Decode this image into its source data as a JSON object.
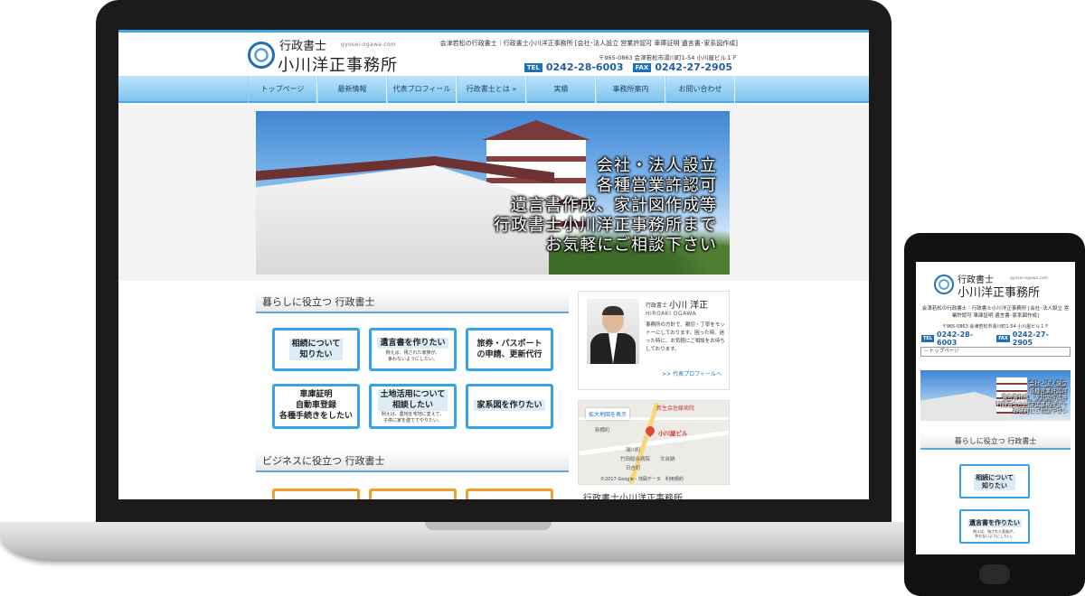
{
  "site": {
    "logo_line1": "行政書士",
    "logo_line2": "小川洋正事務所",
    "domain": "gyosei-ogawa.com",
    "header_desc": "会津若松の行政書士｜行政書士小川洋正事務所 [会社･法人設立 営業許認可 車庫証明 遺言書･家系図作成]",
    "address": "〒965-0863 会津若松市湯川町1-54 小川屋ビル１Ｆ",
    "tel_label": "TEL",
    "tel": "0242-28-6003",
    "fax_label": "FAX",
    "fax": "0242-27-2905"
  },
  "nav": {
    "items": [
      {
        "label": "トップページ"
      },
      {
        "label": "最新情報"
      },
      {
        "label": "代表プロフィール"
      },
      {
        "label": "行政書士とは »"
      },
      {
        "label": "実績"
      },
      {
        "label": "事務所案内"
      },
      {
        "label": "お問い合わせ"
      }
    ]
  },
  "hero": {
    "lines": [
      "会社・法人設立",
      "各種営業許認可",
      "遺言書作成、家計図作成等",
      "行政書士小川洋正事務所まで",
      "お気軽にご相談下さい"
    ]
  },
  "section_life": {
    "title": "暮らしに役立つ 行政書士",
    "services": [
      {
        "title1": "相続について",
        "title2": "知りたい",
        "sub1": "",
        "sub2": ""
      },
      {
        "title1": "遺言書を作りたい",
        "title2": "",
        "sub1": "例えば、残された家族が、",
        "sub2": "争わないようにしたい。"
      },
      {
        "title1": "旅券・パスポート",
        "title2": "の申請、更新代行",
        "sub1": "",
        "sub2": ""
      },
      {
        "title1": "車庫証明",
        "title2": "自動車登録",
        "title3": "各種手続きをしたい",
        "sub1": "",
        "sub2": ""
      },
      {
        "title1": "土地活用について",
        "title2": "相談したい",
        "sub1": "例えば、農地を宅地に変えて、",
        "sub2": "子供に家を建ててやりたい。"
      },
      {
        "title1": "家系図を作りたい",
        "title2": "",
        "sub1": "",
        "sub2": ""
      }
    ]
  },
  "section_business": {
    "title": "ビジネスに役立つ 行政書士"
  },
  "profile": {
    "title": "行政書士",
    "name": "小川 洋正",
    "roman": "HIROAKI OGAWA",
    "text": "事務所の方針で、親切・丁寧をモットーにしております。困った時、迷った時に、お気軽にご相談をお待ちしております。",
    "link": ">> 代表プロフィールへ"
  },
  "map": {
    "zoom_label": "拡大地図を表示",
    "hospital": "新生会佐藤病院",
    "building": "小川屋ビル",
    "label_a": "新横町",
    "label_b": "湯川町",
    "label_c": "竹田総合病院",
    "label_d": "日吉町",
    "label_e": "文台跡",
    "copyright": "©2017 Google - 地図データ　利用規約",
    "caption": "行政書士小川洋正事務所"
  },
  "mobile": {
    "select_label": "-- トップページ",
    "hero_lines": [
      "会社・法人設立",
      "各種営業許認可",
      "遺言書作成、家計図作成等",
      "行政書士小川洋正事務所まで",
      "お気軽にご相談下さい"
    ],
    "section_title": "暮らしに役立つ 行政書士",
    "svc1_title1": "相続について",
    "svc1_title2": "知りたい",
    "svc2_title": "遺言書を作りたい",
    "svc2_sub1": "例えば、残された家族が、",
    "svc2_sub2": "争わないようにしたい。"
  },
  "colors": {
    "accent": "#35a4e8",
    "nav_border": "#4aa8e1",
    "brand_blue": "#1f6fb4",
    "business_accent": "#f0a030"
  }
}
